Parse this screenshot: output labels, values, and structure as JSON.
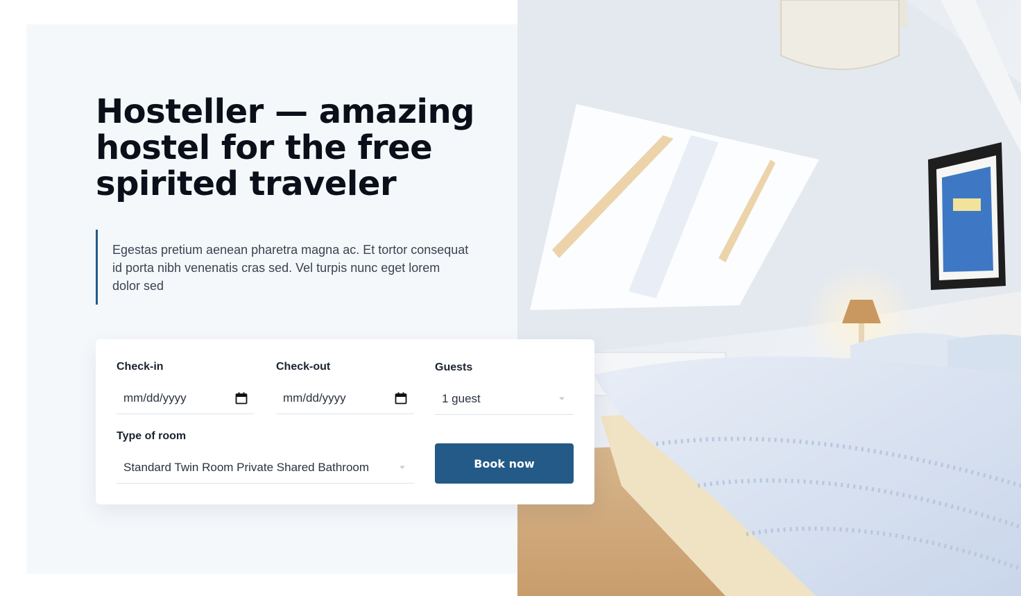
{
  "hero": {
    "title": "Hosteller — amazing hostel for the free spirited traveler",
    "description": "Egestas pretium aenean pharetra magna ac. Et tortor consequat id porta nibh venenatis cras sed. Vel turpis nunc eget lorem dolor sed"
  },
  "booking": {
    "checkin_label": "Check-in",
    "checkin_placeholder": "mm/dd/yyyy",
    "checkout_label": "Check-out",
    "checkout_placeholder": "mm/dd/yyyy",
    "guests_label": "Guests",
    "guests_value": "1 guest",
    "room_label": "Type of room",
    "room_value": "Standard Twin Room Private Shared Bathroom",
    "book_label": "Book now"
  },
  "icons": {
    "date": "calendar-icon",
    "select": "chevron-down-icon"
  },
  "colors": {
    "accent": "#235a87",
    "panel_background": "#f5f8fb",
    "heading": "#0b0f19"
  }
}
